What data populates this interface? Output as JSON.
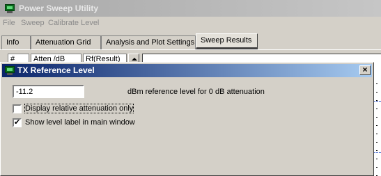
{
  "main_window": {
    "title": "Power Sweep Utility",
    "menu": [
      "File",
      "Sweep",
      "Calibrate Level"
    ],
    "tabs": [
      {
        "label": "Info",
        "active": false
      },
      {
        "label": "Attenuation Grid",
        "active": false
      },
      {
        "label": "Analysis and Plot Settings",
        "active": false
      },
      {
        "label": "Sweep Results",
        "active": true
      }
    ],
    "grid_headers": [
      "#",
      "Atten /dB",
      "Rf(Result)"
    ]
  },
  "dialog": {
    "title": "TX Reference Level",
    "close_label": "×",
    "reference_value": "-11.2",
    "reference_label": "dBm reference level for 0 dB attenuation",
    "checkboxes": [
      {
        "label": "Display relative attenuation only",
        "checked": false
      },
      {
        "label": "Show level label in main window",
        "checked": true
      }
    ]
  },
  "colors": {
    "dialog_title_start": "#0a246a",
    "dialog_title_end": "#a6caf0",
    "inactive_title": "#a8a8a8",
    "window_face": "#d4d0c8"
  }
}
